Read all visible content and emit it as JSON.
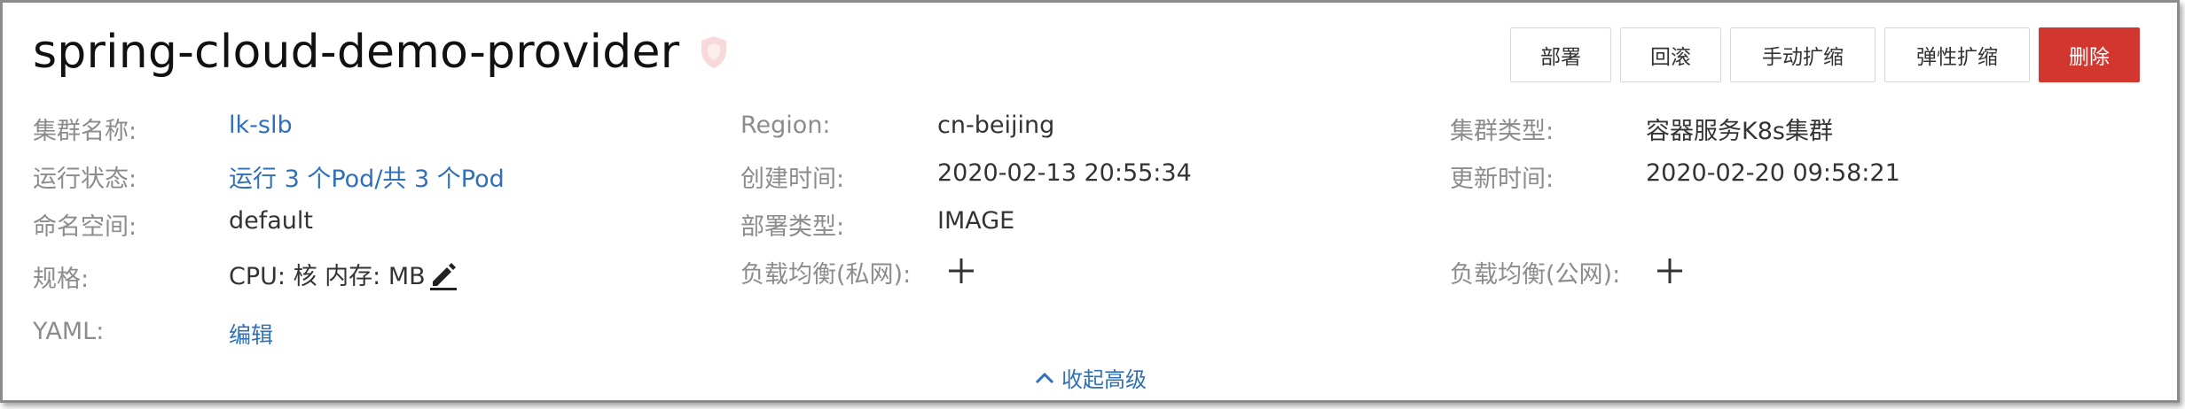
{
  "header": {
    "title": "spring-cloud-demo-provider",
    "shield_icon": "shield-icon",
    "buttons": {
      "deploy": "部署",
      "rollback": "回滚",
      "manual_scale": "手动扩缩",
      "elastic_scale": "弹性扩缩",
      "delete": "删除"
    },
    "delete_color": "#d2372f"
  },
  "details": {
    "cluster_name_label": "集群名称:",
    "cluster_name_value": "lk-slb",
    "region_label": "Region:",
    "region_value": "cn-beijing",
    "cluster_type_label": "集群类型:",
    "cluster_type_value": "容器服务K8s集群",
    "run_status_label": "运行状态:",
    "run_status_value": "运行 3 个Pod/共 3 个Pod",
    "created_label": "创建时间:",
    "created_value": "2020-02-13 20:55:34",
    "updated_label": "更新时间:",
    "updated_value": "2020-02-20 09:58:21",
    "namespace_label": "命名空间:",
    "namespace_value": "default",
    "deploy_type_label": "部署类型:",
    "deploy_type_value": "IMAGE",
    "spec_label": "规格:",
    "spec_value": "CPU: 核 内存: MB",
    "lb_private_label": "负载均衡(私网):",
    "lb_public_label": "负载均衡(公网):",
    "yaml_label": "YAML:",
    "yaml_value": "编辑"
  },
  "footer": {
    "collapse_label": "收起高级"
  },
  "colors": {
    "link": "#2f70b8",
    "label": "#8c8c8c"
  }
}
